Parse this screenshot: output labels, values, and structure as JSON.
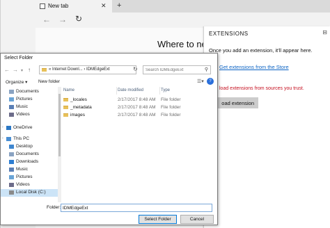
{
  "browser": {
    "tab_title": "New tab",
    "tab_close": "✕",
    "new_tab": "+",
    "heading": "Where to nex"
  },
  "extensions": {
    "title": "EXTENSIONS",
    "message": "Once you add an extension, it'll appear here.",
    "store_link": "Get extensions from the Store",
    "warning": "load extensions from sources you trust.",
    "load_button": "oad extension"
  },
  "dialog": {
    "title": "Select Folder",
    "breadcrumb": "«  Internet Downl...  ›  IDMEdgeExt",
    "search_placeholder": "Search IDMEdgeExt",
    "organize": "Organize ▾",
    "new_folder": "New folder",
    "columns": {
      "name": "Name",
      "date": "Date modified",
      "type": "Type"
    },
    "nav_items": [
      {
        "label": "Documents",
        "icon": "documents"
      },
      {
        "label": "Pictures",
        "icon": "pictures"
      },
      {
        "label": "Music",
        "icon": "music"
      },
      {
        "label": "Videos",
        "icon": "videos"
      },
      {
        "label": "OneDrive",
        "icon": "onedrive"
      },
      {
        "label": "This PC",
        "icon": "pc"
      },
      {
        "label": "Desktop",
        "icon": "desktop"
      },
      {
        "label": "Documents",
        "icon": "documents"
      },
      {
        "label": "Downloads",
        "icon": "downloads"
      },
      {
        "label": "Music",
        "icon": "music"
      },
      {
        "label": "Pictures",
        "icon": "pictures"
      },
      {
        "label": "Videos",
        "icon": "videos"
      },
      {
        "label": "Local Disk (C:)",
        "icon": "disk"
      }
    ],
    "files": [
      {
        "name": "_locales",
        "date": "2/17/2017 8:48 AM",
        "type": "File folder"
      },
      {
        "name": "_metadata",
        "date": "2/17/2017 8:48 AM",
        "type": "File folder"
      },
      {
        "name": "images",
        "date": "2/17/2017 8:48 AM",
        "type": "File folder"
      }
    ],
    "folder_label": "Folder:",
    "folder_value": "IDMEdgeExt",
    "select_button": "Select Folder",
    "cancel_button": "Cancel"
  }
}
